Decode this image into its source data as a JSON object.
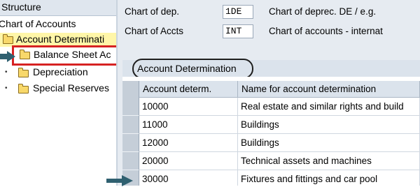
{
  "tree": {
    "header": "Structure",
    "items": [
      {
        "label": "Chart of Accounts"
      },
      {
        "label": "Account Determinati"
      },
      {
        "label": "Balance Sheet Ac"
      },
      {
        "label": "Depreciation"
      },
      {
        "label": "Special Reserves"
      }
    ]
  },
  "header_fields": {
    "chart_of_dep": {
      "label": "Chart of dep.",
      "value": "1DE",
      "desc": "Chart of deprec. DE / e.g."
    },
    "chart_of_accts": {
      "label": "Chart of Accts",
      "value": "INT",
      "desc": "Chart of accounts - internat"
    }
  },
  "table": {
    "title": "Account Determination",
    "columns": [
      "Account determ.",
      "Name for account determination"
    ],
    "rows": [
      [
        "10000",
        "Real estate and similar rights and build"
      ],
      [
        "11000",
        "Buildings"
      ],
      [
        "12000",
        "Buildings"
      ],
      [
        "20000",
        "Technical assets and machines"
      ],
      [
        "30000",
        "Fixtures and fittings and car pool"
      ]
    ]
  },
  "colors": {
    "arrow": "#2f6070",
    "highlight_box": "#d62222",
    "folder": "#f8d86a"
  },
  "icons": [
    "folder-icon",
    "pointer-arrow-icon"
  ]
}
